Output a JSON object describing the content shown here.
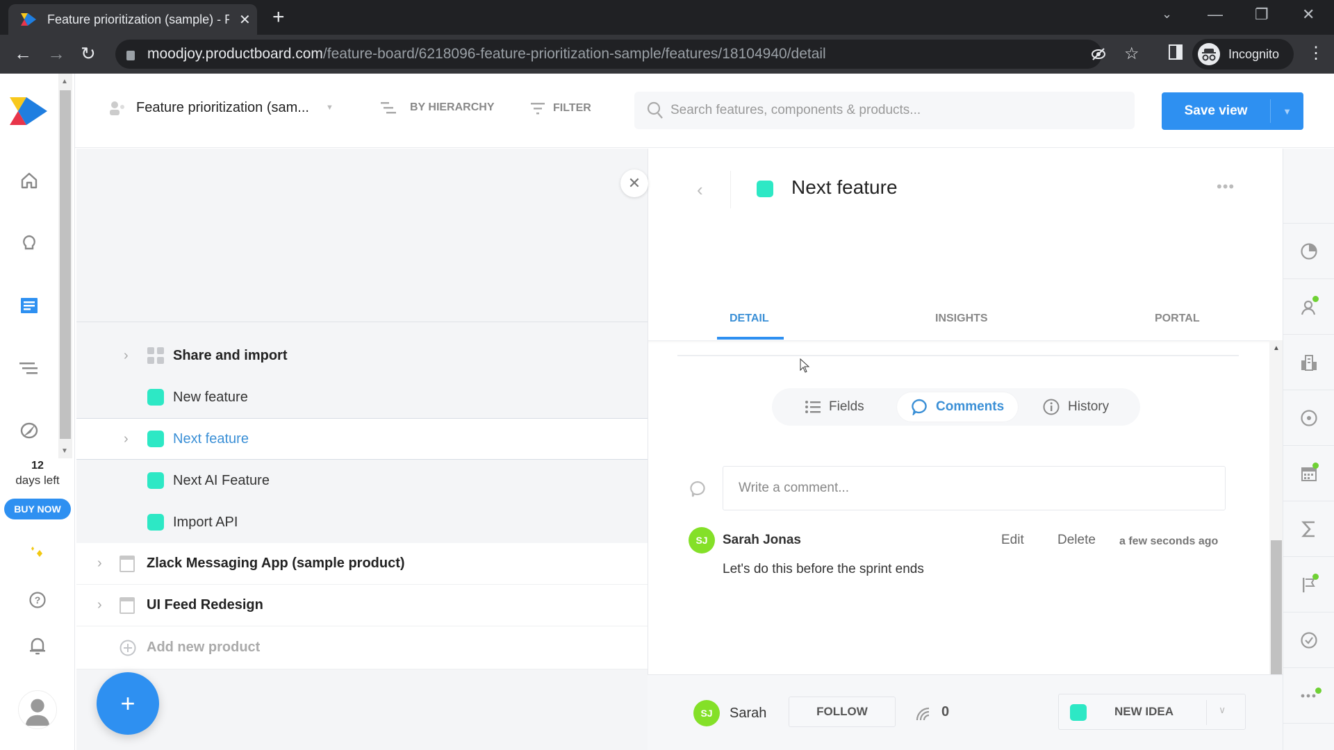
{
  "browser": {
    "tab_title": "Feature prioritization (sample) - P",
    "url_host": "moodjoy.productboard.com",
    "url_path": "/feature-board/6218096-feature-prioritization-sample/features/18104940/detail",
    "profile_label": "Incognito"
  },
  "header": {
    "board_name": "Feature prioritization (sam...",
    "group_by_label": "BY HIERARCHY",
    "filter_label": "FILTER",
    "search_placeholder": "Search features, components & products...",
    "save_view_label": "Save view"
  },
  "leftnav": {
    "trial_days": "12",
    "trial_label": "days left",
    "buy_now_label": "BUY NOW",
    "items": [
      "home-icon",
      "insights-icon",
      "features-board-icon",
      "roadmap-icon",
      "portal-icon",
      "ai-sparkle-icon",
      "help-icon",
      "notifications-icon",
      "user-avatar"
    ]
  },
  "tree": {
    "rows": [
      {
        "label": "Share and import",
        "type": "component",
        "expandable": true
      },
      {
        "label": "New feature",
        "type": "feature",
        "expandable": false
      },
      {
        "label": "Next feature",
        "type": "feature",
        "expandable": true,
        "selected": true
      },
      {
        "label": "Next AI Feature",
        "type": "feature",
        "expandable": false
      },
      {
        "label": "Import API",
        "type": "feature",
        "expandable": false
      },
      {
        "label": "Zlack Messaging App (sample product)",
        "type": "product",
        "expandable": true
      },
      {
        "label": "UI Feed Redesign",
        "type": "product",
        "expandable": true
      }
    ],
    "add_product_label": "Add new product"
  },
  "detail": {
    "title": "Next feature",
    "status_color": "#2de8c5",
    "tabs": [
      {
        "label": "DETAIL",
        "active": true
      },
      {
        "label": "INSIGHTS",
        "active": false
      },
      {
        "label": "PORTAL",
        "active": false
      }
    ],
    "segments": [
      {
        "label": "Fields",
        "active": false
      },
      {
        "label": "Comments",
        "active": true
      },
      {
        "label": "History",
        "active": false
      }
    ],
    "comment_placeholder": "Write a comment...",
    "comments": [
      {
        "initials": "SJ",
        "author": "Sarah Jonas",
        "edit_label": "Edit",
        "delete_label": "Delete",
        "time": "a few seconds ago",
        "text": "Let's do this before the sprint ends"
      }
    ]
  },
  "footer": {
    "owner_initials": "SJ",
    "owner_name": "Sarah",
    "follow_label": "FOLLOW",
    "watchers_count": "0",
    "status_label": "NEW IDEA"
  },
  "rail": {
    "items": [
      {
        "icon": "pie-chart-icon",
        "badge": false
      },
      {
        "icon": "user-insight-icon",
        "badge": true
      },
      {
        "icon": "company-icon",
        "badge": false
      },
      {
        "icon": "target-icon",
        "badge": false
      },
      {
        "icon": "calculator-icon",
        "badge": true
      },
      {
        "icon": "sigma-icon",
        "badge": false
      },
      {
        "icon": "flag-icon",
        "badge": true
      },
      {
        "icon": "check-circle-icon",
        "badge": false
      },
      {
        "icon": "more-icon",
        "badge": true
      }
    ]
  },
  "colors": {
    "accent": "#2e90f1",
    "feature_teal": "#2de8c5",
    "avatar_green": "#84e028",
    "badge_green": "#6fd134"
  }
}
